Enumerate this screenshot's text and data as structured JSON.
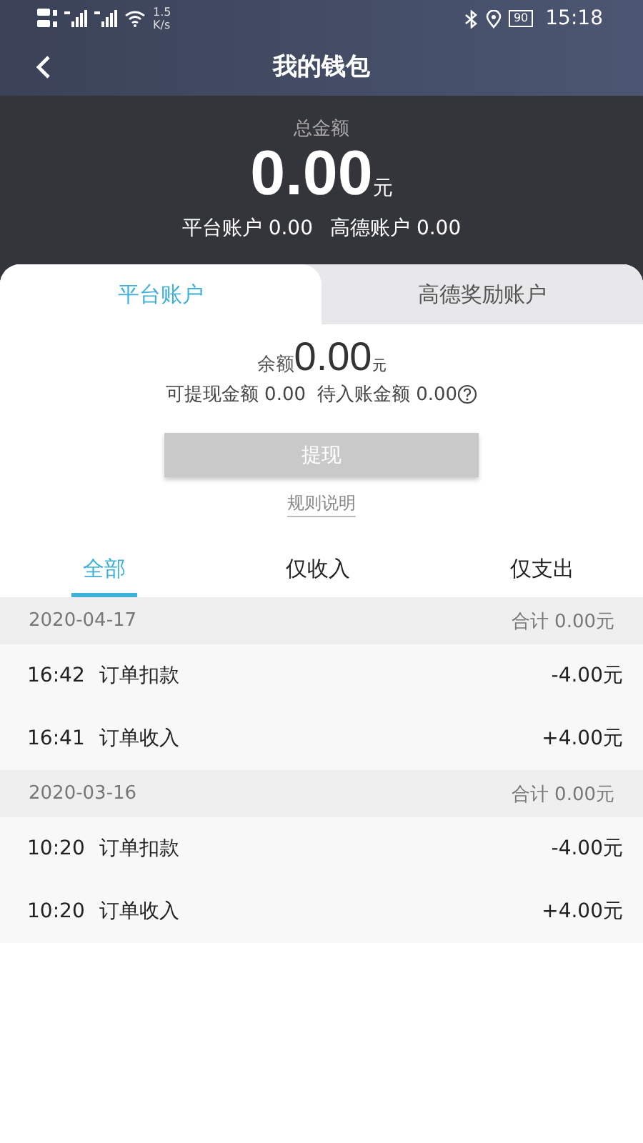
{
  "status_bar": {
    "network_speed": "1.5",
    "network_speed_unit": "K/s",
    "battery": "90",
    "time": "15:18"
  },
  "header": {
    "title": "我的钱包"
  },
  "summary": {
    "label": "总金额",
    "amount": "0.00",
    "unit": "元",
    "accounts": [
      "平台账户 0.00",
      "高德账户 0.00"
    ]
  },
  "account_tabs": [
    {
      "label": "平台账户",
      "selected": true
    },
    {
      "label": "高德奖励账户",
      "selected": false
    }
  ],
  "balance": {
    "label": "余额",
    "amount": "0.00",
    "unit": "元",
    "details": [
      "可提现金额 0.00",
      "待入账金额 0.00"
    ]
  },
  "withdraw_button": {
    "label": "提现",
    "disabled": true
  },
  "rules_link": "规则说明",
  "filter_tabs": [
    {
      "label": "全部",
      "selected": true
    },
    {
      "label": "仅收入",
      "selected": false
    },
    {
      "label": "仅支出",
      "selected": false
    }
  ],
  "groups": [
    {
      "date": "2020-04-17",
      "total": "合计 0.00元",
      "items": [
        {
          "time": "16:42",
          "title": "订单扣款",
          "amount": "-4.00元"
        },
        {
          "time": "16:41",
          "title": "订单收入",
          "amount": "+4.00元"
        }
      ]
    },
    {
      "date": "2020-03-16",
      "total": "合计 0.00元",
      "items": [
        {
          "time": "10:20",
          "title": "订单扣款",
          "amount": "-4.00元"
        },
        {
          "time": "10:20",
          "title": "订单收入",
          "amount": "+4.00元"
        }
      ]
    }
  ]
}
